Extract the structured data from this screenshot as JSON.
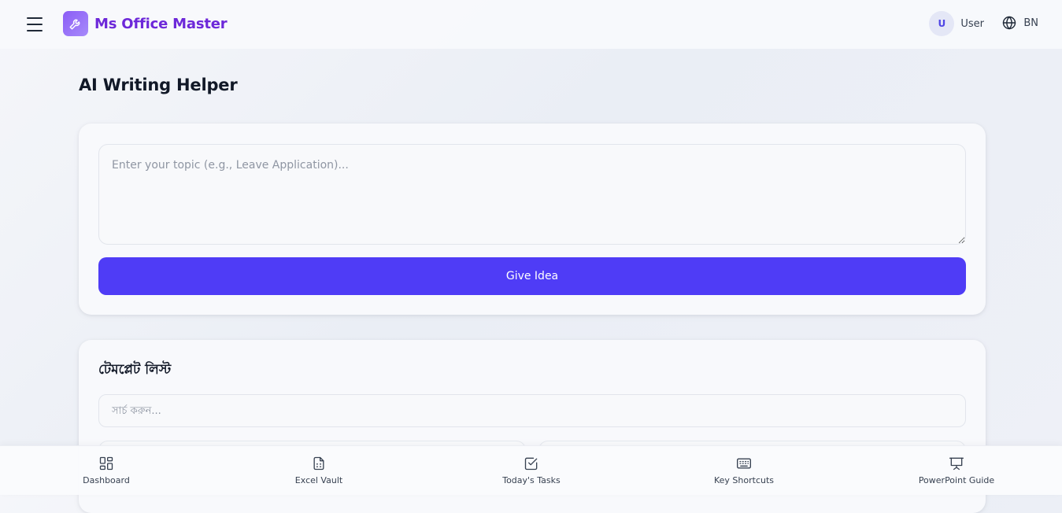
{
  "header": {
    "app_name": "Ms Office Master",
    "user_initial": "U",
    "user_label": "User",
    "language": "BN"
  },
  "page": {
    "title": "AI Writing Helper"
  },
  "idea_card": {
    "topic_placeholder": "Enter your topic (e.g., Leave Application)...",
    "topic_value": "",
    "button_label": "Give Idea"
  },
  "templates": {
    "title": "টেমপ্লেট লিস্ট",
    "search_placeholder": "সার্চ করুন...",
    "search_value": ""
  },
  "bottom_nav": {
    "items": [
      {
        "label": "Dashboard",
        "icon": "dashboard-icon"
      },
      {
        "label": "Excel Vault",
        "icon": "document-icon"
      },
      {
        "label": "Today's Tasks",
        "icon": "checkbox-icon"
      },
      {
        "label": "Key Shortcuts",
        "icon": "keyboard-icon"
      },
      {
        "label": "PowerPoint Guide",
        "icon": "presentation-icon"
      }
    ]
  },
  "colors": {
    "brand": "#6d28d9",
    "primary_button": "#4f3cf6",
    "avatar_bg": "#e4e7f6",
    "avatar_text": "#4f46e5"
  }
}
